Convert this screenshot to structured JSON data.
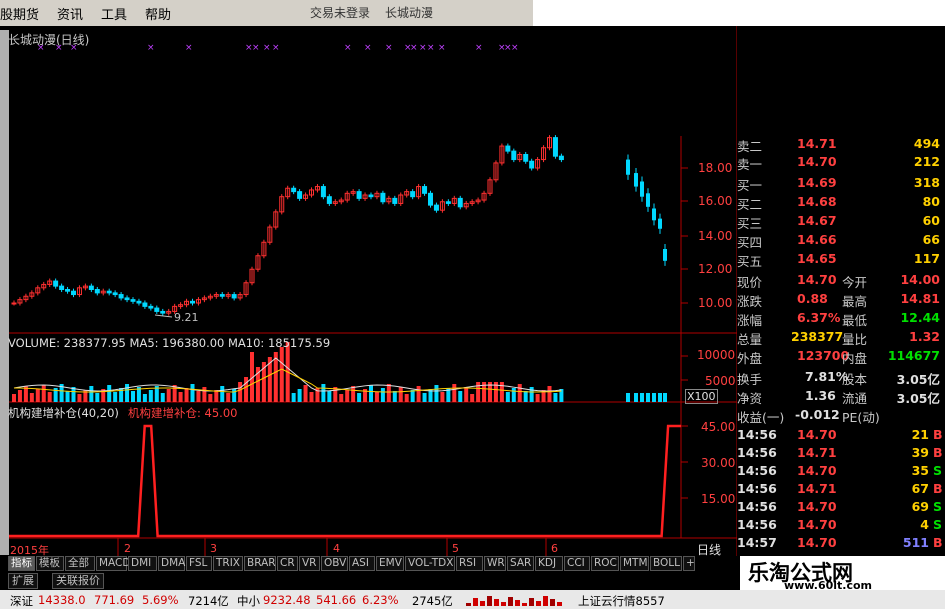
{
  "menu": {
    "items": [
      "股期货",
      "资讯",
      "工具",
      "帮助"
    ],
    "title_left": "交易未登录",
    "title_right": "长城动漫"
  },
  "chart": {
    "title": "长城动漫(日线)",
    "low_marker": "9.21",
    "price_axis": [
      "18.00",
      "16.00",
      "14.00",
      "12.00",
      "10.00"
    ],
    "volume_header": "VOLUME: 238377.95  MA5: 196380.00  MA10: 185175.59",
    "volume_axis": [
      "10000",
      "5000"
    ],
    "volume_unit": "X100",
    "indicator_name": "机构建增补仓(40,20)",
    "indicator_value": "机构建增补仓: 45.00",
    "indicator_axis": [
      "45.00",
      "30.00",
      "15.00"
    ],
    "date_labels": [
      "2015年",
      "2",
      "3",
      "4",
      "5",
      "6"
    ],
    "period_label": "日线"
  },
  "chart_data": [
    {
      "type": "line",
      "title": "机构建增补仓(40,20)",
      "ylim": [
        0,
        45
      ],
      "x": [
        0,
        20,
        21,
        22,
        23,
        24,
        100,
        101,
        102,
        103,
        104
      ],
      "series": [
        {
          "name": "机构建增补仓",
          "values": [
            0,
            0,
            45,
            45,
            0,
            0,
            0,
            0,
            45,
            45,
            45
          ]
        }
      ]
    }
  ],
  "quote": {
    "asks": [
      {
        "label": "卖二",
        "price": "14.71",
        "vol": "494"
      },
      {
        "label": "卖一",
        "price": "14.70",
        "vol": "212"
      }
    ],
    "bids": [
      {
        "label": "买一",
        "price": "14.69",
        "vol": "318"
      },
      {
        "label": "买二",
        "price": "14.68",
        "vol": "80"
      },
      {
        "label": "买三",
        "price": "14.67",
        "vol": "60"
      },
      {
        "label": "买四",
        "price": "14.66",
        "vol": "66"
      },
      {
        "label": "买五",
        "price": "14.65",
        "vol": "117"
      }
    ],
    "stats": [
      {
        "l1": "现价",
        "v1": "14.70",
        "l2": "今开",
        "v2": "14.00",
        "c2": "red"
      },
      {
        "l1": "涨跌",
        "v1": "0.88",
        "l2": "最高",
        "v2": "14.81",
        "c2": "red"
      },
      {
        "l1": "涨幅",
        "v1": "6.37%",
        "l2": "最低",
        "v2": "12.44",
        "c2": "grn"
      },
      {
        "l1": "总量",
        "v1": "238377",
        "l2": "量比",
        "v2": "1.32",
        "c2": "red",
        "c1": "yel"
      },
      {
        "l1": "外盘",
        "v1": "123700",
        "l2": "内盘",
        "v2": "114677",
        "c2": "grn"
      }
    ],
    "stats2": [
      {
        "l1": "换手",
        "v1": "7.81%",
        "l2": "股本",
        "v2": "3.05亿"
      },
      {
        "l1": "净资",
        "v1": "1.36",
        "l2": "流通",
        "v2": "3.05亿"
      },
      {
        "l1": "收益(一)",
        "v1": "-0.012",
        "l2": "PE(动)",
        "v2": ""
      }
    ],
    "ticks": [
      {
        "t": "14:56",
        "p": "14.70",
        "v": "21",
        "f": "B"
      },
      {
        "t": "14:56",
        "p": "14.71",
        "v": "39",
        "f": "B"
      },
      {
        "t": "14:56",
        "p": "14.70",
        "v": "35",
        "f": "S"
      },
      {
        "t": "14:56",
        "p": "14.71",
        "v": "67",
        "f": "B"
      },
      {
        "t": "14:56",
        "p": "14.70",
        "v": "69",
        "f": "S"
      },
      {
        "t": "14:56",
        "p": "14.70",
        "v": "4",
        "f": "S"
      },
      {
        "t": "14:57",
        "p": "14.70",
        "v": "511",
        "f": "B"
      }
    ]
  },
  "tabs": [
    "指标",
    "模板",
    "全部",
    "MACD",
    "DMI",
    "DMA",
    "FSL",
    "TRIX",
    "BRAR",
    "CR",
    "VR",
    "OBV",
    "ASI",
    "EMV",
    "VOL-TDX",
    "RSI",
    "WR",
    "SAR",
    "KDJ",
    "CCI",
    "ROC",
    "MTM",
    "BOLL",
    "+"
  ],
  "subtabs": [
    "扩展",
    "关联报价"
  ],
  "status": {
    "idx1_name": "深证",
    "idx1_val": "14338.0",
    "idx1_chg": "771.69",
    "idx1_pct": "5.69%",
    "idx1_amt": "7214亿",
    "idx2_name": "中小",
    "idx2_val": "9232.48",
    "idx2_chg": "541.66",
    "idx2_pct": "6.23%",
    "idx2_amt": "2745亿",
    "feed": "上证云行情8557"
  },
  "watermark": {
    "big": "乐淘公式网",
    "url": "www.60lt.com"
  }
}
